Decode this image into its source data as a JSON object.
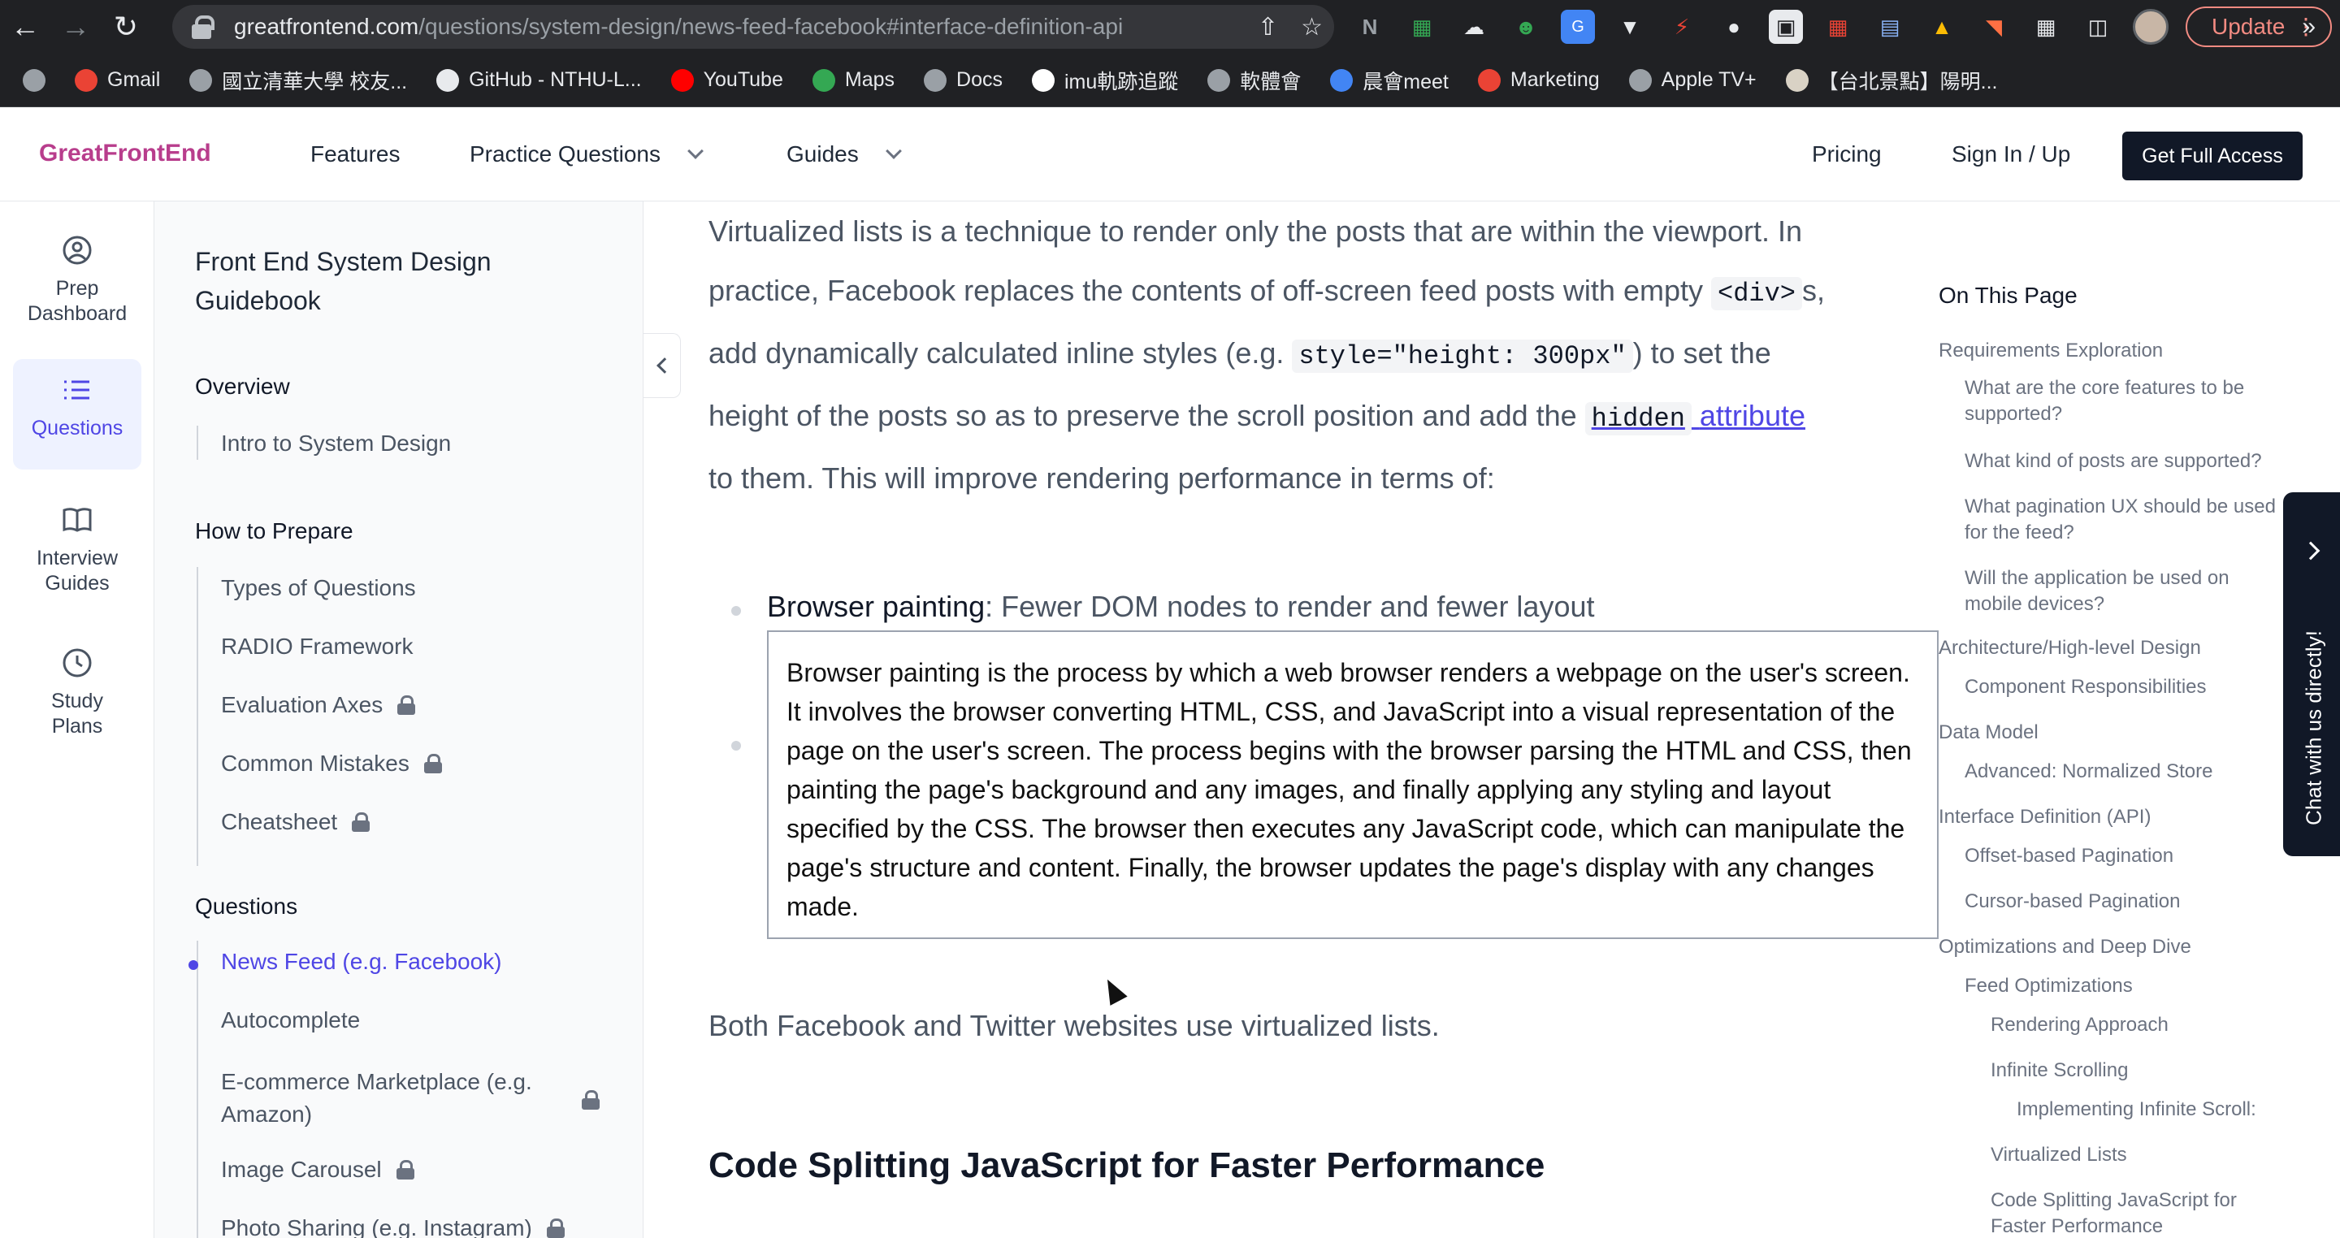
{
  "browser": {
    "url_host": "greatfrontend.com",
    "url_path": "/questions/system-design/news-feed-facebook#interface-definition-api",
    "update_label": "Update",
    "bookmarks": [
      "Gmail",
      "國立清華大學 校友...",
      "GitHub - NTHU-L...",
      "YouTube",
      "Maps",
      "Docs",
      "imu軌跡追蹤",
      "軟體會",
      "晨會meet",
      "Marketing",
      "Apple TV+",
      "【台北景點】陽明..."
    ],
    "bookmark_colors": [
      "#9aa0a6",
      "#ea4335",
      "#9aa0a6",
      "#e8eaed",
      "#ff0000",
      "#34a853",
      "#9aa0a6",
      "#ffffff",
      "#9aa0a6",
      "#4285f4",
      "#ea4335",
      "#9aa0a6",
      "#d9d2c5"
    ]
  },
  "header": {
    "logo": "GreatFrontEnd",
    "nav": [
      "Features",
      "Practice Questions",
      "Guides"
    ],
    "pricing": "Pricing",
    "sign_in": "Sign In / Up",
    "cta": "Get Full Access"
  },
  "rail": {
    "items": [
      {
        "label_1": "Prep",
        "label_2": "Dashboard",
        "icon": "user-circle-icon"
      },
      {
        "label_1": "Questions",
        "icon": "list-icon"
      },
      {
        "label_1": "Interview",
        "label_2": "Guides",
        "icon": "book-icon"
      },
      {
        "label_1": "Study",
        "label_2": "Plans",
        "icon": "clock-icon"
      }
    ]
  },
  "guide": {
    "title": "Front End System Design Guidebook",
    "sections": {
      "overview": "Overview",
      "prepare": "How to Prepare",
      "questions": "Questions"
    },
    "overview_items": [
      "Intro to System Design"
    ],
    "prepare_items": [
      "Types of Questions",
      "RADIO Framework",
      "Evaluation Axes",
      "Common Mistakes",
      "Cheatsheet"
    ],
    "question_items": [
      "News Feed (e.g. Facebook)",
      "Autocomplete",
      "E-commerce Marketplace (e.g.",
      "Amazon)",
      "Image Carousel",
      "Photo Sharing (e.g. Instagram)"
    ]
  },
  "article": {
    "p1_a": "Virtualized lists is a technique to render only the posts that are within the viewport. In practice, Facebook replaces the contents of off-screen feed posts with empty ",
    "code_div": "<div>",
    "p1_b": "s, add dynamically calculated inline styles (e.g. ",
    "code_style": "style=\"height: 300px\"",
    "p1_c": ") to set the height of the posts so as to preserve the scroll position and add the ",
    "code_hidden": "hidden",
    "link_attribute": "attribute",
    "p1_d": " to them. This will improve rendering performance in terms of:",
    "bullet_bold": "Browser painting",
    "bullet_rest": ": Fewer DOM nodes to render and fewer layout",
    "tooltip": "Browser painting is the process by which a web browser renders a webpage on the user's screen. It involves the browser converting HTML, CSS, and JavaScript into a visual representation of the page on the user's screen. The process begins with the browser parsing the HTML and CSS, then painting the page's background and any images, and finally applying any styling and layout specified by the CSS. The browser then executes any JavaScript code, which can manipulate the page's structure and content. Finally, the browser updates the page's display with any changes made.",
    "p2": "Both Facebook and Twitter websites use virtualized lists.",
    "h2": "Code Splitting JavaScript for Faster Performance"
  },
  "toc": {
    "title": "On This Page",
    "items": [
      "Requirements Exploration",
      "What are the core features to be supported?",
      "What kind of posts are supported?",
      "What pagination UX should be used for the feed?",
      "Will the application be used on mobile devices?",
      "Architecture/High-level Design",
      "Component Responsibilities",
      "Data Model",
      "Advanced: Normalized Store",
      "Interface Definition (API)",
      "Offset-based Pagination",
      "Cursor-based Pagination",
      "Optimizations and Deep Dive",
      "Feed Optimizations",
      "Rendering Approach",
      "Infinite Scrolling",
      "Implementing Infinite Scroll:",
      "Virtualized Lists",
      "Code Splitting JavaScript for Faster Performance"
    ]
  },
  "chat": {
    "label": "Chat with us directly!"
  }
}
